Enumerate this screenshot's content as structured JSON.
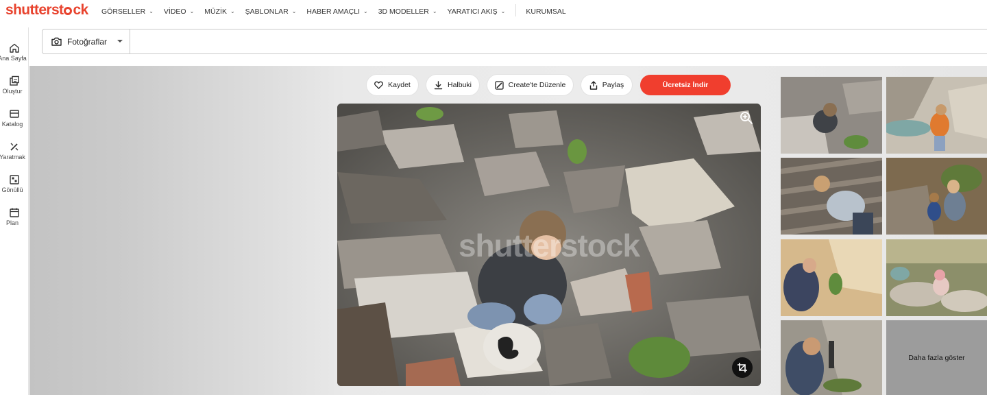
{
  "brand": {
    "logo_left": "shutterst",
    "logo_right": "ck",
    "accent": "#e8432e"
  },
  "nav": {
    "items": [
      {
        "label": "GÖRSELLER",
        "chevron": true
      },
      {
        "label": "VİDEO",
        "chevron": true
      },
      {
        "label": "MÜZİK",
        "chevron": true
      },
      {
        "label": "ŞABLONLAR",
        "chevron": true
      },
      {
        "label": "HABER AMAÇLI",
        "chevron": true
      },
      {
        "label": "3D MODELLER",
        "chevron": true
      },
      {
        "label": "YARATICI AKIŞ",
        "chevron": true
      }
    ],
    "extra": "KURUMSAL"
  },
  "sidebar": {
    "items": [
      {
        "label": "Ana Sayfa",
        "icon": "home-icon"
      },
      {
        "label": "Oluştur",
        "icon": "create-icon"
      },
      {
        "label": "Katalog",
        "icon": "catalog-icon"
      },
      {
        "label": "Yaratmak",
        "icon": "magic-wand-icon"
      },
      {
        "label": "Gönüllü",
        "icon": "grid-icon"
      },
      {
        "label": "Plan",
        "icon": "plan-icon"
      }
    ]
  },
  "search": {
    "type_label": "Fotoğraflar",
    "value": "",
    "placeholder": ""
  },
  "actions": {
    "save": "Kaydet",
    "download": "Halbuki",
    "edit": "Create'te Düzenle",
    "share": "Paylaş",
    "free_download": "Ücretsiz İndir",
    "primary_color": "#f03e2e"
  },
  "photo": {
    "watermark": "shutterstock"
  },
  "thumbnails": {
    "show_more": "Daha fazla göster"
  }
}
